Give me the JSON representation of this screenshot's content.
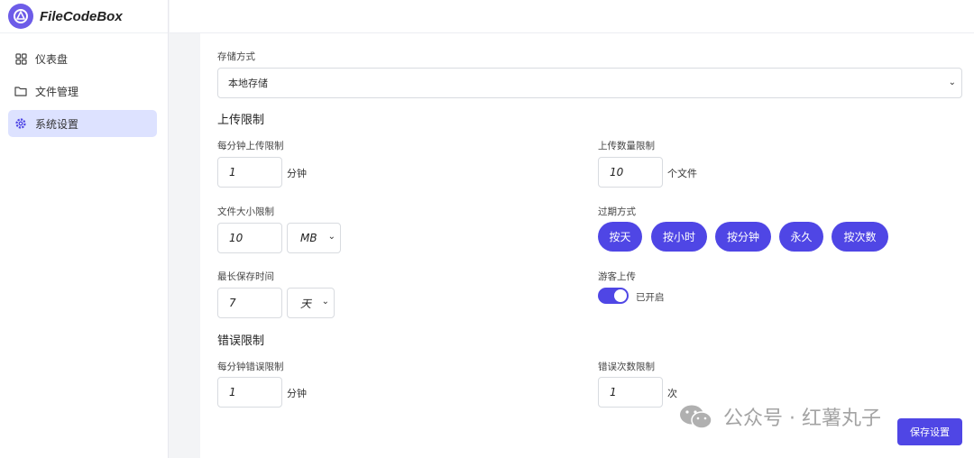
{
  "app": {
    "name": "FileCodeBox"
  },
  "sidebar": {
    "items": [
      {
        "label": "仪表盘",
        "icon": "grid-icon"
      },
      {
        "label": "文件管理",
        "icon": "folder-icon"
      },
      {
        "label": "系统设置",
        "icon": "gear-icon",
        "active": true
      }
    ]
  },
  "storage": {
    "label": "存储方式",
    "value": "本地存储"
  },
  "upload_limit": {
    "title": "上传限制",
    "per_minute": {
      "label": "每分钟上传限制",
      "value": "1",
      "unit": "分钟"
    },
    "count": {
      "label": "上传数量限制",
      "value": "10",
      "unit": "个文件"
    },
    "size": {
      "label": "文件大小限制",
      "value": "10",
      "unit": "MB"
    },
    "expire": {
      "label": "过期方式",
      "options": [
        "按天",
        "按小时",
        "按分钟",
        "永久",
        "按次数"
      ]
    },
    "max_keep": {
      "label": "最长保存时间",
      "value": "7",
      "unit": "天"
    },
    "guest": {
      "label": "游客上传",
      "status": "已开启",
      "enabled": true
    }
  },
  "error_limit": {
    "title": "错误限制",
    "per_minute": {
      "label": "每分钟错误限制",
      "value": "1",
      "unit": "分钟"
    },
    "count": {
      "label": "错误次数限制",
      "value": "1",
      "unit": "次"
    }
  },
  "actions": {
    "save_label": "保存设置"
  },
  "watermark": {
    "text": "公众号 · 红薯丸子"
  },
  "colors": {
    "accent": "#4f46e5",
    "active_nav": "#dde2ff",
    "logo": "#6d5ce8"
  }
}
